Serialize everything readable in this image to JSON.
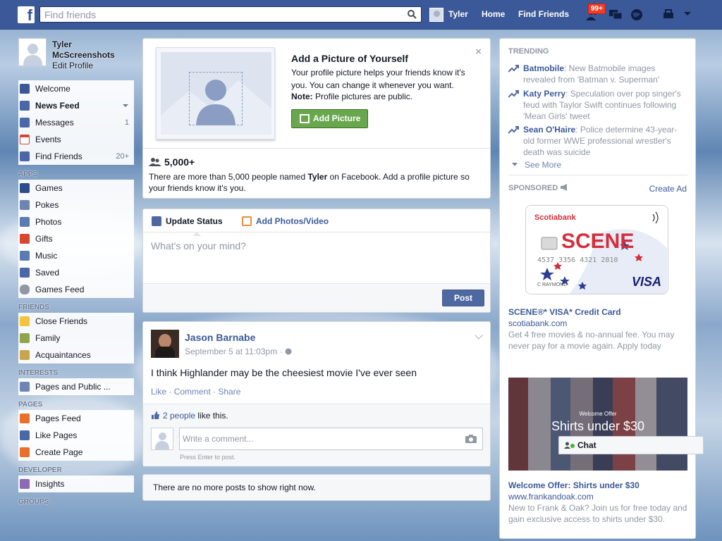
{
  "topbar": {
    "logo": "f",
    "search_placeholder": "Find friends",
    "user": "Tyler",
    "home": "Home",
    "find_friends": "Find Friends",
    "notif_count": "99+"
  },
  "left": {
    "profile_name": "Tyler McScreenshots",
    "edit_profile": "Edit Profile",
    "favorites": [
      {
        "label": "Welcome",
        "count": "",
        "color": "#3b5998"
      },
      {
        "label": "News Feed",
        "count": "",
        "color": "#4a67a8"
      },
      {
        "label": "Messages",
        "count": "1",
        "color": "#4a67a8"
      },
      {
        "label": "Events",
        "count": "",
        "color": "#d8462e"
      },
      {
        "label": "Find Friends",
        "count": "20+",
        "color": "#4a67a8"
      }
    ],
    "apps_label": "APPS",
    "apps": [
      "Games",
      "Pokes",
      "Photos",
      "Gifts",
      "Music",
      "Saved",
      "Games Feed"
    ],
    "friends_label": "FRIENDS",
    "friends": [
      "Close Friends",
      "Family",
      "Acquaintances"
    ],
    "interests_label": "INTERESTS",
    "interests": [
      "Pages and Public ..."
    ],
    "pages_label": "PAGES",
    "pages": [
      "Pages Feed",
      "Like Pages",
      "Create Page"
    ],
    "developer_label": "DEVELOPER",
    "developer": [
      "Insights"
    ],
    "groups_label": "GROUPS"
  },
  "addpic": {
    "title": "Add a Picture of Yourself",
    "desc": "Your profile picture helps your friends know it's you. You can change it whenever you want.",
    "note_label": "Note:",
    "note_text": " Profile pictures are public.",
    "button": "Add Picture",
    "close": "×",
    "count": "5,000+",
    "info_pre": "There are more than 5,000 people named ",
    "info_name": "Tyler",
    "info_post": " on Facebook. Add a profile picture so your friends know it's you."
  },
  "composer": {
    "tab_status": "Update Status",
    "tab_photo": "Add Photos/Video",
    "placeholder": "What's on your mind?",
    "post": "Post"
  },
  "post": {
    "author": "Jason Barnabe",
    "meta": "September 5 at 11:03pm · ",
    "text": "I think Highlander may be the cheesiest movie I've ever seen",
    "like": "Like",
    "comment": "Comment",
    "share": "Share",
    "likes_link": "2 people",
    "likes_text": " like this.",
    "comment_placeholder": "Write a comment...",
    "hint": "Press Enter to post."
  },
  "nomore": "There are no more posts to show right now.",
  "right": {
    "trending_label": "TRENDING",
    "trends": [
      {
        "name": "Batmobile",
        "text": ": New Batmobile images revealed from 'Batman v. Superman'"
      },
      {
        "name": "Katy Perry",
        "text": ": Speculation over pop singer's feud with Taylor Swift continues following 'Mean Girls' tweet"
      },
      {
        "name": "Sean O'Haire",
        "text": ": Police determine 43-year-old former WWE professional wrestler's death was suicide"
      }
    ],
    "see_more": "See More",
    "sponsored_label": "SPONSORED",
    "create_ad": "Create Ad",
    "ad1": {
      "card_bank": "Scotiabank",
      "card_brand": "SCENE",
      "card_network": "VISA",
      "card_number": "4537 3356 4321 2810",
      "card_holder": "C RAYMOND",
      "title": "SCENE®* VISA* Credit Card",
      "url": "scotiabank.com",
      "desc": "Get 4 free movies & no-annual fee. You may never pay for a movie again. Apply today"
    },
    "ad2": {
      "img_small": "Welcome Offer",
      "img_big": "Shirts under $30",
      "title": "Welcome Offer: Shirts under $30",
      "url": "www.frankandoak.com",
      "desc": "New to Frank & Oak? Join us for free today and gain exclusive access to shirts under $30."
    }
  },
  "chat": "Chat"
}
